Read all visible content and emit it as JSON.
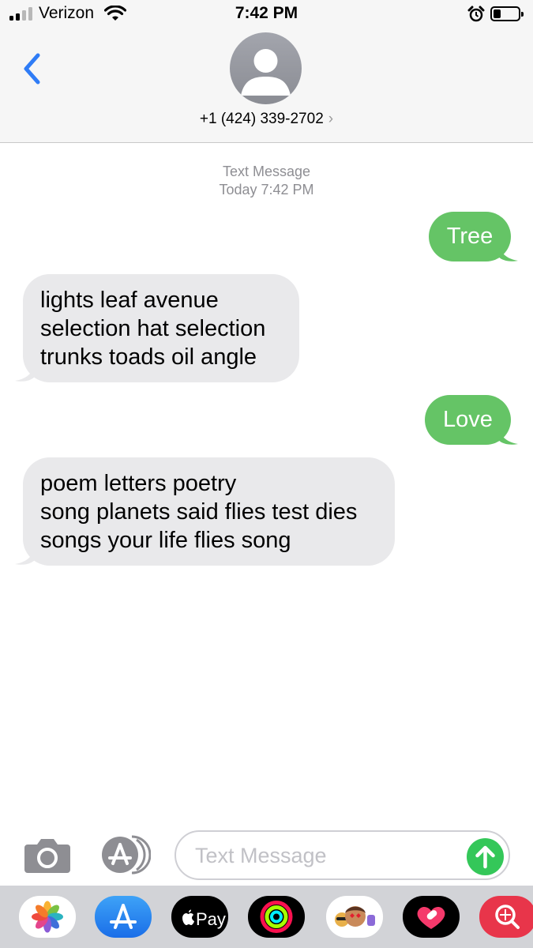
{
  "status_bar": {
    "carrier": "Verizon",
    "time": "7:42 PM",
    "signal_bars_active": 2,
    "battery_level": 0.25
  },
  "nav": {
    "contact": "+1 (424) 339-2702",
    "chevron": "›"
  },
  "conversation": {
    "service_label": "Text Message",
    "timestamp": "Today 7:42 PM",
    "messages": [
      {
        "direction": "sent",
        "lines": [
          "Tree"
        ]
      },
      {
        "direction": "received",
        "lines": [
          "lights leaf avenue",
          "selection hat selection",
          "trunks toads oil angle"
        ]
      },
      {
        "direction": "sent",
        "lines": [
          "Love"
        ]
      },
      {
        "direction": "received",
        "lines": [
          "poem letters poetry",
          "song planets said flies test dies",
          "songs your life flies song"
        ]
      }
    ]
  },
  "composer": {
    "placeholder": "Text Message"
  },
  "app_drawer": {
    "apps": [
      {
        "name": "photos-app-icon",
        "label": ""
      },
      {
        "name": "app-store-app-icon",
        "label": ""
      },
      {
        "name": "apple-pay-app-icon",
        "label": "Pay"
      },
      {
        "name": "activity-app-icon",
        "label": ""
      },
      {
        "name": "memoji-app-icon",
        "label": ""
      },
      {
        "name": "digital-touch-app-icon",
        "label": ""
      },
      {
        "name": "images-search-app-icon",
        "label": ""
      }
    ]
  },
  "colors": {
    "sent_bubble": "#65c466",
    "received_bubble": "#e9e9eb",
    "accent_blue": "#2f7cf6",
    "send_button": "#34c759"
  }
}
